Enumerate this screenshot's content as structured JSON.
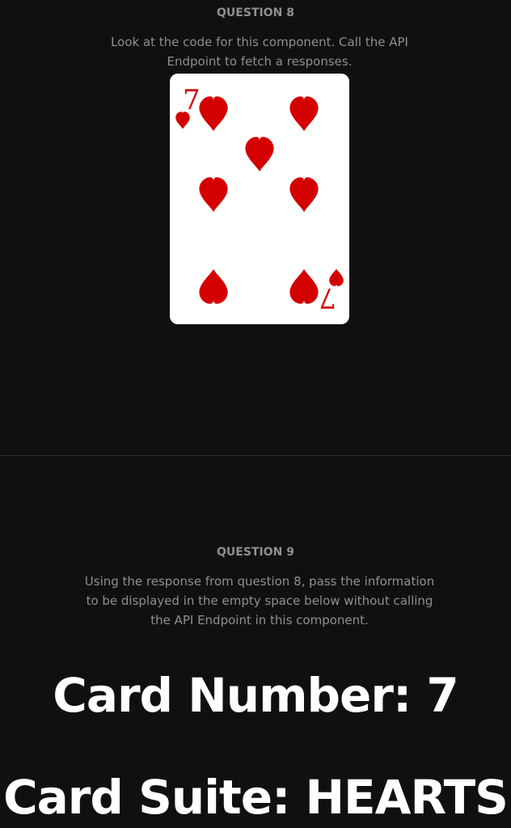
{
  "question8": {
    "heading": "QUESTION 8",
    "description": "Look at the code for this component. Call the API Endpoint to fetch a responses."
  },
  "card": {
    "rank": "7",
    "suit": "HEARTS",
    "suit_color": "#d40000",
    "icon": "heart-icon"
  },
  "question9": {
    "heading": "QUESTION 9",
    "description": "Using the response from question 8, pass the information to be displayed in the empty space below without calling the API Endpoint in this component."
  },
  "result": {
    "number_line": "Card Number: 7",
    "suite_line": "Card Suite: HEARTS"
  },
  "colors": {
    "background": "#101010",
    "muted_text": "#8f8f8f",
    "bright_text": "#ffffff",
    "divider": "#2c2c2c"
  }
}
